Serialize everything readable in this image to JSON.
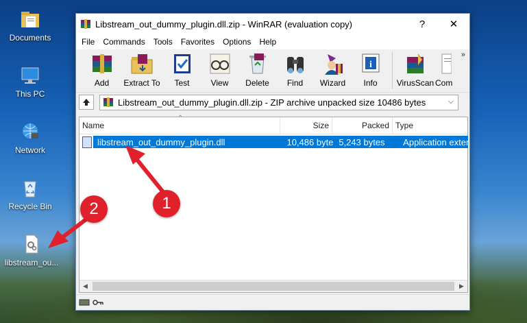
{
  "desktop": {
    "icons": [
      {
        "label": "Documents"
      },
      {
        "label": "This PC"
      },
      {
        "label": "Network"
      },
      {
        "label": "Recycle Bin"
      },
      {
        "label": "libstream_ou..."
      }
    ]
  },
  "window": {
    "title": "Libstream_out_dummy_plugin.dll.zip - WinRAR (evaluation copy)",
    "help_glyph": "?",
    "close_glyph": "✕"
  },
  "menu": [
    "File",
    "Commands",
    "Tools",
    "Favorites",
    "Options",
    "Help"
  ],
  "toolbar": {
    "buttons": [
      {
        "label": "Add",
        "icon": "add-archive-icon"
      },
      {
        "label": "Extract To",
        "icon": "extract-folder-icon"
      },
      {
        "label": "Test",
        "icon": "test-check-icon"
      },
      {
        "label": "View",
        "icon": "view-glasses-icon"
      },
      {
        "label": "Delete",
        "icon": "delete-recycle-icon"
      },
      {
        "label": "Find",
        "icon": "find-binoculars-icon"
      },
      {
        "label": "Wizard",
        "icon": "wizard-icon"
      },
      {
        "label": "Info",
        "icon": "info-icon"
      },
      {
        "label": "VirusScan",
        "icon": "virusscan-icon"
      },
      {
        "label": "Com",
        "icon": "comment-icon"
      }
    ],
    "more_glyph": "»"
  },
  "address": {
    "path": "Libstream_out_dummy_plugin.dll.zip - ZIP archive unpacked size 10486 bytes"
  },
  "list": {
    "columns": [
      "Name",
      "Size",
      "Packed",
      "Type"
    ],
    "rows": [
      {
        "name": "libstream_out_dummy_plugin.dll",
        "size": "10,486 byte",
        "packed": "5,243 bytes",
        "type": "Application extens"
      }
    ]
  },
  "annotations": {
    "badge1": "1",
    "badge2": "2"
  },
  "colors": {
    "accent": "#0078d7",
    "badge": "#e0212b"
  }
}
